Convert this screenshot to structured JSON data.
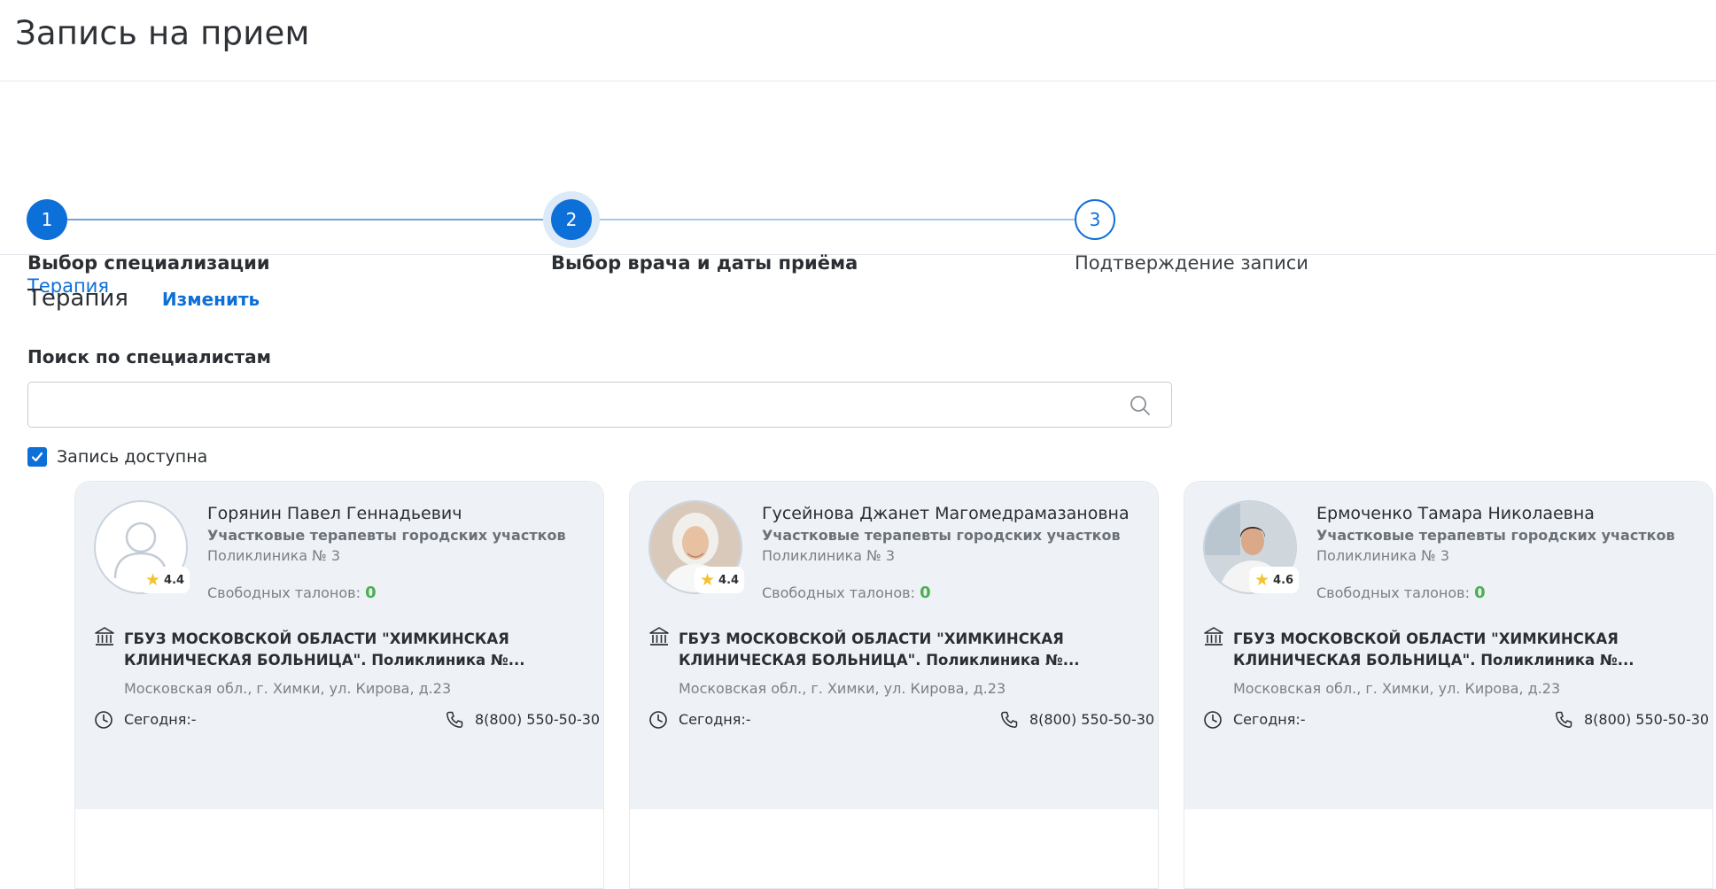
{
  "page": {
    "title": "Запись на прием"
  },
  "stepper": {
    "steps": [
      {
        "number": "1",
        "label": "Выбор специализации",
        "sub": "Терапия"
      },
      {
        "number": "2",
        "label": "Выбор врача и даты приёма"
      },
      {
        "number": "3",
        "label": "Подтверждение записи"
      }
    ]
  },
  "specialization": {
    "title": "Терапия",
    "change_label": "Изменить"
  },
  "search": {
    "label": "Поиск по специалистам",
    "value": "",
    "placeholder": ""
  },
  "filter": {
    "available_label": "Запись доступна",
    "checked": true
  },
  "cards": [
    {
      "name": "Горянин Павел Геннадьевич",
      "specialty": "Участковые терапевты городских участков",
      "clinic": "Поликлиника № 3",
      "rating": "4.4",
      "tickets_label": "Свободных талонов:",
      "tickets_count": "0",
      "org": "ГБУЗ МОСКОВСКОЙ ОБЛАСТИ \"ХИМКИНСКАЯ КЛИНИЧЕСКАЯ БОЛЬНИЦА\". Поликлиника №...",
      "address": "Московская обл., г. Химки, ул. Кирова, д.23",
      "today": "Сегодня:-",
      "phone": "8(800) 550-50-30",
      "avatar": "placeholder-person-icon"
    },
    {
      "name": "Гусейнова Джанет Магомедрамазановна",
      "specialty": "Участковые терапевты городских участков",
      "clinic": "Поликлиника № 3",
      "rating": "4.4",
      "tickets_label": "Свободных талонов:",
      "tickets_count": "0",
      "org": "ГБУЗ МОСКОВСКОЙ ОБЛАСТИ \"ХИМКИНСКАЯ КЛИНИЧЕСКАЯ БОЛЬНИЦА\". Поликлиника №...",
      "address": "Московская обл., г. Химки, ул. Кирова, д.23",
      "today": "Сегодня:-",
      "phone": "8(800) 550-50-30",
      "avatar": "doctor-photo"
    },
    {
      "name": "Ермоченко Тамара Николаевна",
      "specialty": "Участковые терапевты городских участков",
      "clinic": "Поликлиника № 3",
      "rating": "4.6",
      "tickets_label": "Свободных талонов:",
      "tickets_count": "0",
      "org": "ГБУЗ МОСКОВСКОЙ ОБЛАСТИ \"ХИМКИНСКАЯ КЛИНИЧЕСКАЯ БОЛЬНИЦА\". Поликлиника №...",
      "address": "Московская обл., г. Химки, ул. Кирова, д.23",
      "today": "Сегодня:-",
      "phone": "8(800) 550-50-30",
      "avatar": "doctor-photo"
    }
  ],
  "colors": {
    "accent": "#0d6fd8",
    "card_bg": "#eef2f6",
    "tickets": "#4caf50",
    "star": "#f5c12e"
  }
}
